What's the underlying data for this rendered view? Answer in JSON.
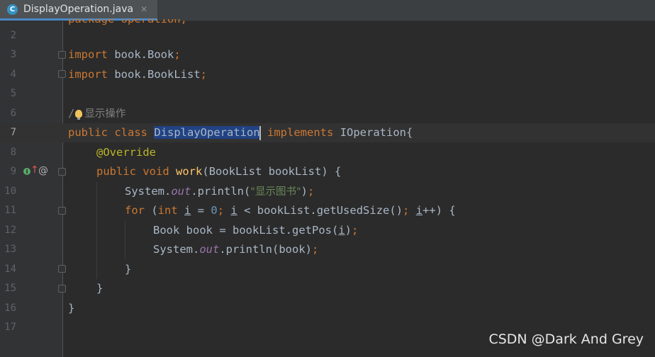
{
  "tab": {
    "file_icon_letter": "C",
    "filename": "DisplayOperation.java",
    "close_glyph": "✕"
  },
  "gutter": {
    "line_numbers": [
      "2",
      "3",
      "4",
      "5",
      "6",
      "7",
      "8",
      "9",
      "10",
      "11",
      "12",
      "13",
      "14",
      "15",
      "16",
      "17"
    ],
    "current_line": "7",
    "implements_icon_letter": "I",
    "override_arrow": "↑",
    "annotation_marker": "@"
  },
  "code": {
    "line1_partial": "package operation;",
    "import1_kw": "import",
    "import1_path": "book.Book",
    "import2_kw": "import",
    "import2_path": "book.BookList",
    "comment_slash": "/",
    "comment_text": "显示操作",
    "class_mod": "public",
    "class_kw": "class",
    "class_name": "DisplayOperation",
    "implements_kw": "implements",
    "interface_name": "IOperation",
    "override_ann": "@Override",
    "method_mod": "public",
    "method_ret": "void",
    "method_name": "work",
    "param_type": "BookList",
    "param_name": "bookList",
    "println_prefix": "System.",
    "println_field": "out",
    "println_call": ".println(",
    "string_literal": "\"显示图书\"",
    "for_kw": "for",
    "int_kw": "int",
    "loop_var": "i",
    "zero": "0",
    "loop_cond_mid": "bookList.getUsedSize()",
    "incr": "++",
    "decl_type": "Book",
    "decl_name": "book",
    "decl_rhs": "bookList.getPos(",
    "println2_arg": "book"
  },
  "watermark": "CSDN @Dark And Grey"
}
